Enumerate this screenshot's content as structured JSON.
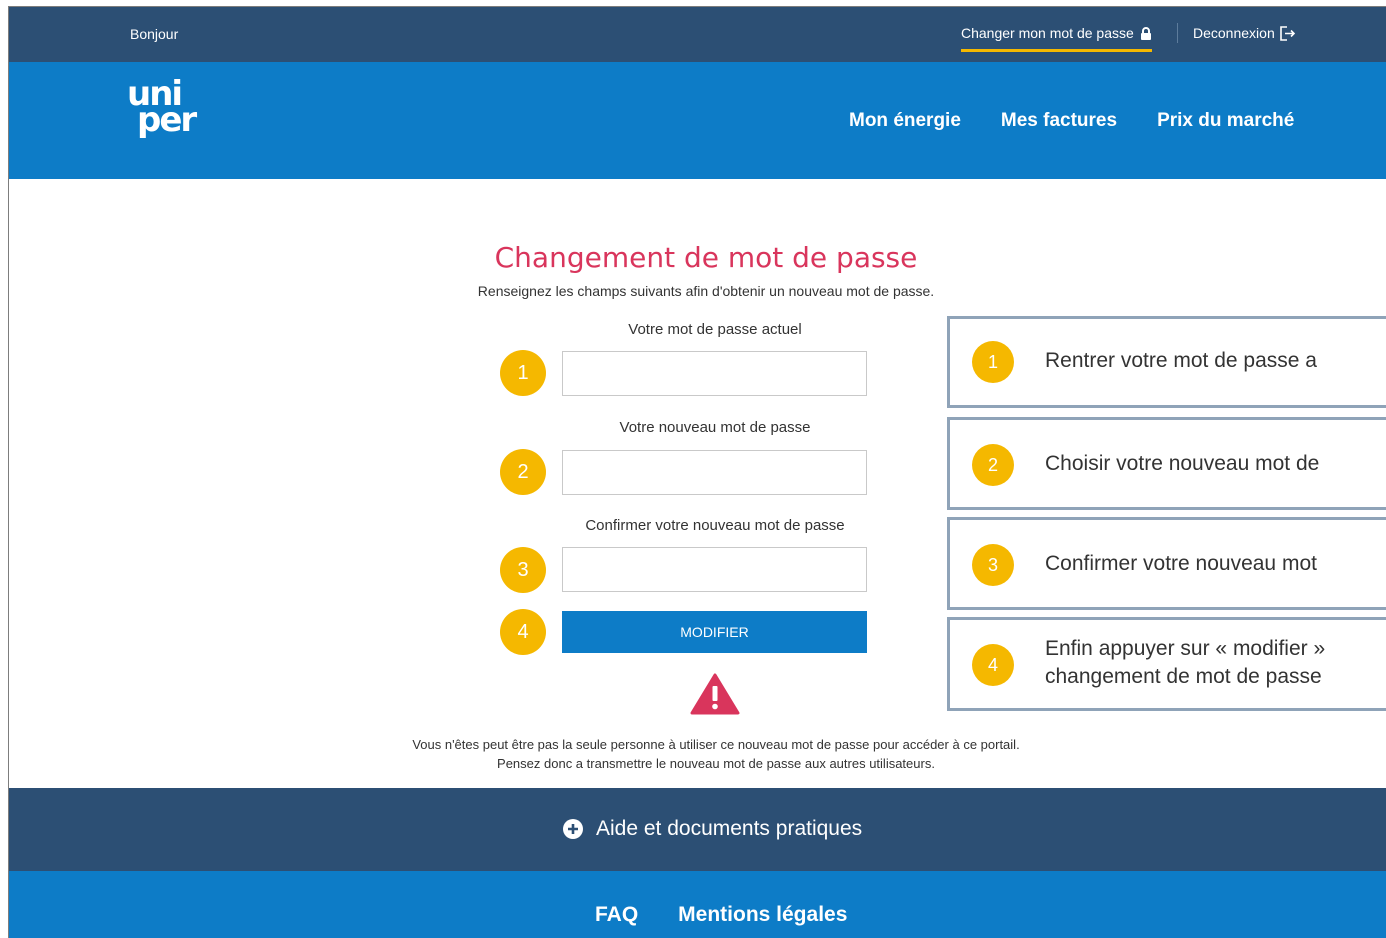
{
  "topbar": {
    "greeting": "Bonjour",
    "change_password": "Changer mon mot de passe",
    "logout": "Deconnexion"
  },
  "header": {
    "logo_line1": "uni",
    "logo_line2": "per",
    "nav": [
      "Mon énergie",
      "Mes factures",
      "Prix du marché"
    ]
  },
  "form": {
    "title": "Changement de mot de passe",
    "subtitle": "Renseignez les champs suivants afin d'obtenir un nouveau mot de passe.",
    "fields": [
      {
        "label": "Votre mot de passe actuel",
        "badge": "1"
      },
      {
        "label": "Votre nouveau mot de passe",
        "badge": "2"
      },
      {
        "label": "Confirmer votre nouveau mot de passe",
        "badge": "3"
      }
    ],
    "submit_badge": "4",
    "submit_label": "MODIFIER",
    "warning_line1": "Vous n'êtes peut être pas la seule personne à utiliser ce nouveau mot de passe pour accéder à ce portail.",
    "warning_line2": "Pensez donc a transmettre le nouveau mot de passe aux autres utilisateurs."
  },
  "callouts": [
    {
      "badge": "1",
      "text": "Rentrer votre mot de passe a"
    },
    {
      "badge": "2",
      "text": "Choisir votre nouveau mot de"
    },
    {
      "badge": "3",
      "text": "Confirmer votre nouveau mot"
    },
    {
      "badge": "4",
      "text_line1": "Enfin appuyer sur « modifier »",
      "text_line2": "changement de mot de passe"
    }
  ],
  "help": {
    "label": "Aide et documents pratiques"
  },
  "footer": {
    "links": [
      "FAQ",
      "Mentions légales"
    ]
  },
  "colors": {
    "topbar": "#2c4f74",
    "header": "#0d7cc7",
    "accent_yellow": "#f5b800",
    "title_pink": "#d9355c"
  }
}
